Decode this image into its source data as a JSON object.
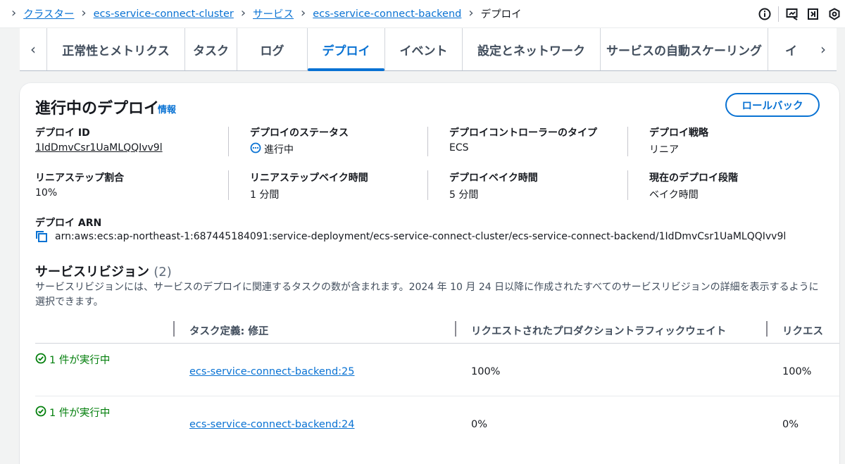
{
  "breadcrumb": {
    "items": [
      "クラスター",
      "ecs-service-connect-cluster",
      "サービス",
      "ecs-service-connect-backend"
    ],
    "current": "デプロイ"
  },
  "tabs": [
    "正常性とメトリクス",
    "タスク",
    "ログ",
    "デプロイ",
    "イベント",
    "設定とネットワーク",
    "サービスの自動スケーリング",
    "イ"
  ],
  "active_tab": "デプロイ",
  "panel": {
    "title": "進行中のデプロイ",
    "info": "情報",
    "rollback": "ロールバック"
  },
  "details": {
    "deploy_id": {
      "label": "デプロイ ID",
      "value": "1IdDmvCsr1UaMLQQIvv9l"
    },
    "deploy_status": {
      "label": "デプロイのステータス",
      "value": "進行中"
    },
    "controller": {
      "label": "デプロイコントローラーのタイプ",
      "value": "ECS"
    },
    "strategy": {
      "label": "デプロイ戦略",
      "value": "リニア"
    },
    "step_pct": {
      "label": "リニアステップ割合",
      "value": "10%"
    },
    "step_bake": {
      "label": "リニアステップベイク時間",
      "value": "1 分間"
    },
    "bake": {
      "label": "デプロイベイク時間",
      "value": "5 分間"
    },
    "stage": {
      "label": "現在のデプロイ段階",
      "value": "ベイク時間"
    },
    "arn": {
      "label": "デプロイ ARN",
      "value": "arn:aws:ecs:ap-northeast-1:687445184091:service-deployment/ecs-service-connect-cluster/ecs-service-connect-backend/1IdDmvCsr1UaMLQQIvv9l"
    }
  },
  "revisions": {
    "title": "サービスリビジョン",
    "count": "(2)",
    "description": "サービスリビジョンには、サービスのデプロイに関連するタスクの数が含まれます。2024 年 10 月 24 日以降に作成されたすべてのサービスリビジョンの詳細を表示するように選択できます。",
    "columns": [
      "タスク定義: 修正",
      "リクエストされたプロダクショントラフィックウェイト",
      "リクエス"
    ],
    "rows": [
      {
        "status": "1 件が実行中",
        "task_def": "ecs-service-connect-backend:25",
        "requested_weight": "100%",
        "next": "100%"
      },
      {
        "status": "1 件が実行中",
        "task_def": "ecs-service-connect-backend:24",
        "requested_weight": "0%",
        "next": "0%"
      }
    ]
  },
  "colors": {
    "link": "#0972d3",
    "success": "#037f0c",
    "text": "#16191f"
  }
}
